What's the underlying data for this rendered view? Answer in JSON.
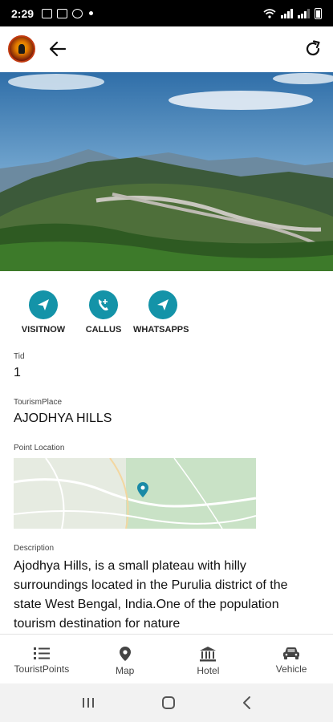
{
  "status_bar": {
    "time": "2:29"
  },
  "details": {
    "actions": [
      {
        "label": "VISITNOW"
      },
      {
        "label": "CALLUS"
      },
      {
        "label": "WHATSAPPS"
      }
    ],
    "tid_label": "Tid",
    "tid_value": "1",
    "place_label": "TourismPlace",
    "place_value": "AJODHYA HILLS",
    "location_label": "Point Location",
    "description_label": "Description",
    "description_text": "Ajodhya Hills, is a small plateau with hilly surroundings located in the Purulia district of the state West Bengal, India.One of the population  tourism destination for nature"
  },
  "bottom_nav": [
    {
      "label": "TouristPoints",
      "icon": "list-icon"
    },
    {
      "label": "Map",
      "icon": "map-pin-icon"
    },
    {
      "label": "Hotel",
      "icon": "hotel-icon"
    },
    {
      "label": "Vehicle",
      "icon": "car-icon"
    }
  ],
  "colors": {
    "accent": "#1493a8"
  }
}
